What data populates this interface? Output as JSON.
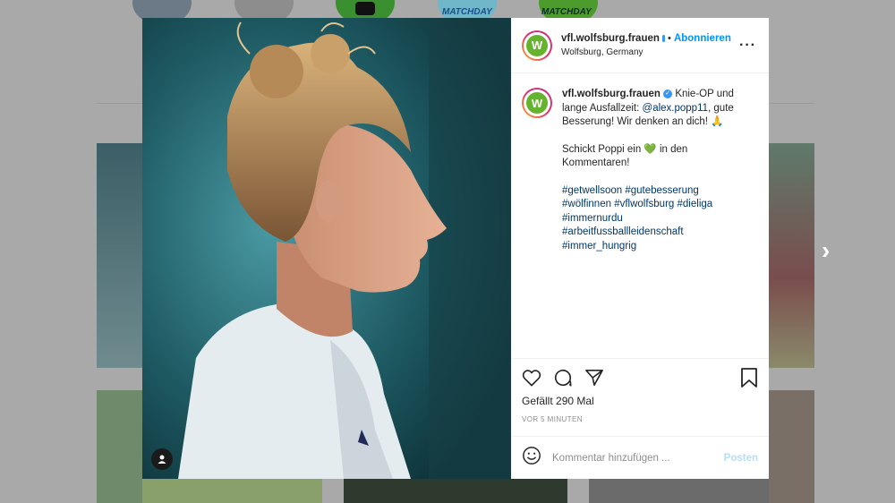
{
  "background": {
    "stories": [
      {
        "label": ""
      },
      {
        "label": ""
      },
      {
        "label": ""
      },
      {
        "label": "MATCHDAY"
      },
      {
        "label": "MATCHDAY"
      }
    ]
  },
  "post": {
    "header": {
      "username": "vfl.wolfsburg.frauen",
      "separator": "•",
      "follow_label": "Abonnieren",
      "location": "Wolfsburg, Germany",
      "more_icon": "more-horizontal-icon"
    },
    "caption": {
      "username": "vfl.wolfsburg.frauen",
      "text_part1": "Knie-OP und lange Ausfallzeit:",
      "mention": "@alex.popp11",
      "text_part2": ", gute Besserung! Wir denken an dich! 🙏",
      "paragraph2_a": "Schickt Poppi ein",
      "paragraph2_emoji": "💚",
      "paragraph2_b": "in den Kommentaren!",
      "hashtags": [
        "#getwellsoon",
        "#gutebesserung",
        "#wölfinnen",
        "#vflwolfsburg",
        "#dieliga",
        "#immernurdu",
        "#arbeitfussballleidenschaft",
        "#immer_hungrig"
      ]
    },
    "actions": {
      "likes": "Gefällt 290 Mal",
      "time": "VOR 5 MINUTEN"
    },
    "comment": {
      "placeholder": "Kommentar hinzufügen ...",
      "post_label": "Posten"
    }
  },
  "colors": {
    "brand_green": "#65b32e",
    "link_blue": "#0095f6",
    "hashtag_blue": "#00376b",
    "post_disabled": "#b2dffc"
  }
}
